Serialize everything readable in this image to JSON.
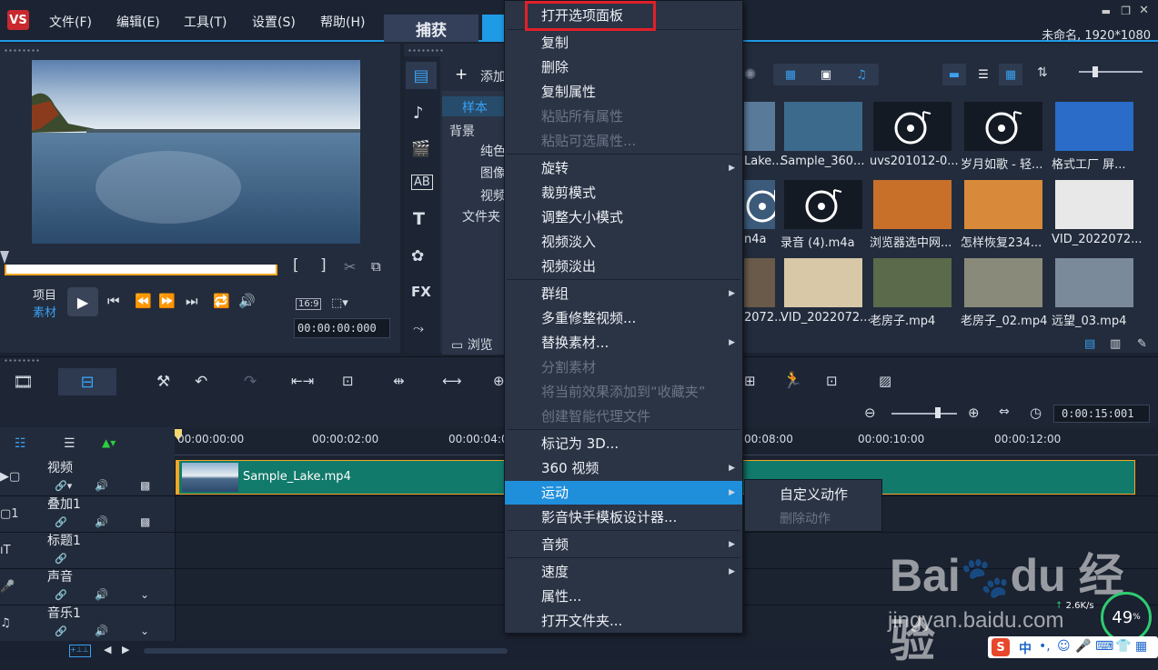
{
  "app": {
    "menu": [
      "文件(F)",
      "编辑(E)",
      "工具(T)",
      "设置(S)",
      "帮助(H)"
    ],
    "tab_capture": "捕获",
    "project_info": "未命名, 1920*1080"
  },
  "preview": {
    "mode_project": "项目",
    "mode_clip": "素材",
    "aspect": "16:9",
    "timecode": "00:00:00:000",
    "bracket_in": "[",
    "bracket_out": "]"
  },
  "library": {
    "add_label": "添加",
    "tree": [
      "样本",
      "背景",
      "纯色",
      "图像",
      "视频",
      "文件夹"
    ],
    "browse": "浏览",
    "thumbs": [
      {
        "caption": "Lake..."
      },
      {
        "caption": "Sample_360..."
      },
      {
        "caption": "uvs201012-0..."
      },
      {
        "caption": "岁月如歌 - 轻..."
      },
      {
        "caption": "格式工厂 屏..."
      },
      {
        "caption": "n4a"
      },
      {
        "caption": "录音 (4).m4a"
      },
      {
        "caption": "浏览器选中网..."
      },
      {
        "caption": "怎样恢复234..."
      },
      {
        "caption": "VID_2022072..."
      },
      {
        "caption": "2072..."
      },
      {
        "caption": "VID_2022072..."
      },
      {
        "caption": "老房子.mp4"
      },
      {
        "caption": "老房子_02.mp4"
      },
      {
        "caption": "远望_03.mp4"
      }
    ]
  },
  "timeline": {
    "zoom_time": "0:00:15:001",
    "ruler": [
      "00:00:00:00",
      "00:00:02:00",
      "00:00:04:0",
      "00:08:00",
      "00:00:10:00",
      "00:00:12:00"
    ],
    "tracks": [
      "视频",
      "叠加1",
      "标题1",
      "声音",
      "音乐1"
    ],
    "clip_name": "Sample_Lake.mp4"
  },
  "context_menu": {
    "items": [
      {
        "label": "打开选项面板",
        "disabled": false
      },
      {
        "label": "复制",
        "disabled": false
      },
      {
        "label": "删除",
        "disabled": false
      },
      {
        "label": "复制属性",
        "disabled": false
      },
      {
        "label": "粘贴所有属性",
        "disabled": true
      },
      {
        "label": "粘贴可选属性...",
        "disabled": true
      },
      {
        "label": "旋转",
        "disabled": false,
        "sub": true
      },
      {
        "label": "裁剪模式",
        "disabled": false
      },
      {
        "label": "调整大小模式",
        "disabled": false
      },
      {
        "label": "视频淡入",
        "disabled": false
      },
      {
        "label": "视频淡出",
        "disabled": false
      },
      {
        "label": "群组",
        "disabled": false,
        "sub": true
      },
      {
        "label": "多重修整视频...",
        "disabled": false
      },
      {
        "label": "替换素材...",
        "disabled": false,
        "sub": true
      },
      {
        "label": "分割素材",
        "disabled": true
      },
      {
        "label": "将当前效果添加到“收藏夹”",
        "disabled": true
      },
      {
        "label": "创建智能代理文件",
        "disabled": true
      },
      {
        "label": "标记为 3D...",
        "disabled": false
      },
      {
        "label": "360 视频",
        "disabled": false,
        "sub": true
      },
      {
        "label": "运动",
        "disabled": false,
        "sub": true,
        "highlighted": true
      },
      {
        "label": "影音快手模板设计器...",
        "disabled": false
      },
      {
        "label": "音频",
        "disabled": false,
        "sub": true
      },
      {
        "label": "速度",
        "disabled": false,
        "sub": true
      },
      {
        "label": "属性...",
        "disabled": false
      },
      {
        "label": "打开文件夹...",
        "disabled": false
      }
    ],
    "submenu": [
      {
        "label": "自定义动作",
        "disabled": false
      },
      {
        "label": "删除动作",
        "disabled": true
      }
    ]
  },
  "watermark": {
    "site": "jingyan.baidu.com"
  },
  "tray": {
    "percent": "49",
    "speed": "2.6",
    "speed_unit": "K/s",
    "ime": "中"
  }
}
